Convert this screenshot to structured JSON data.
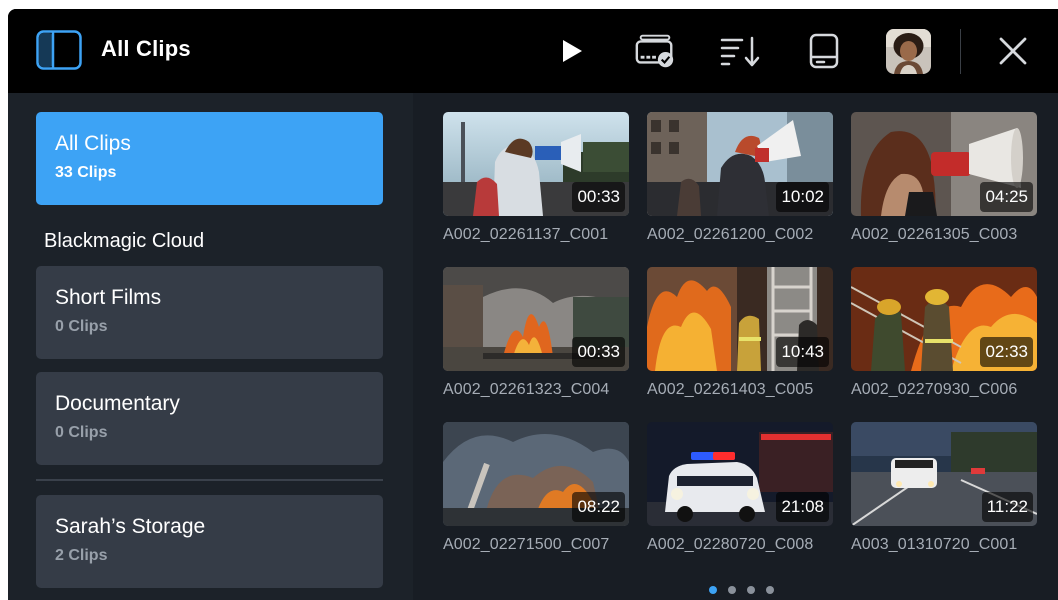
{
  "header": {
    "title": "All Clips",
    "icons": [
      "sidebar-toggle-icon",
      "play-icon",
      "media-select-icon",
      "sort-icon",
      "drive-icon",
      "user-avatar",
      "close-icon"
    ]
  },
  "sidebar": {
    "active": {
      "name": "All Clips",
      "count": "33 Clips"
    },
    "section_label": "Blackmagic Cloud",
    "projects": [
      {
        "name": "Short Films",
        "count": "0 Clips"
      },
      {
        "name": "Documentary",
        "count": "0 Clips"
      }
    ],
    "storage": {
      "name": "Sarah’s Storage",
      "count": "2 Clips"
    }
  },
  "clips": [
    {
      "name": "A002_02261137_C001",
      "duration": "00:33"
    },
    {
      "name": "A002_02261200_C002",
      "duration": "10:02"
    },
    {
      "name": "A002_02261305_C003",
      "duration": "04:25"
    },
    {
      "name": "A002_02261323_C004",
      "duration": "00:33"
    },
    {
      "name": "A002_02261403_C005",
      "duration": "10:43"
    },
    {
      "name": "A002_02270930_C006",
      "duration": "02:33"
    },
    {
      "name": "A002_02271500_C007",
      "duration": "08:22"
    },
    {
      "name": "A002_02280720_C008",
      "duration": "21:08"
    },
    {
      "name": "A003_01310720_C001",
      "duration": "11:22"
    }
  ],
  "pagination": {
    "pages": 4,
    "current": 1
  },
  "colors": {
    "accent": "#3da3f5",
    "card": "#353c47",
    "background": "#181d24",
    "topbar": "#000000"
  }
}
